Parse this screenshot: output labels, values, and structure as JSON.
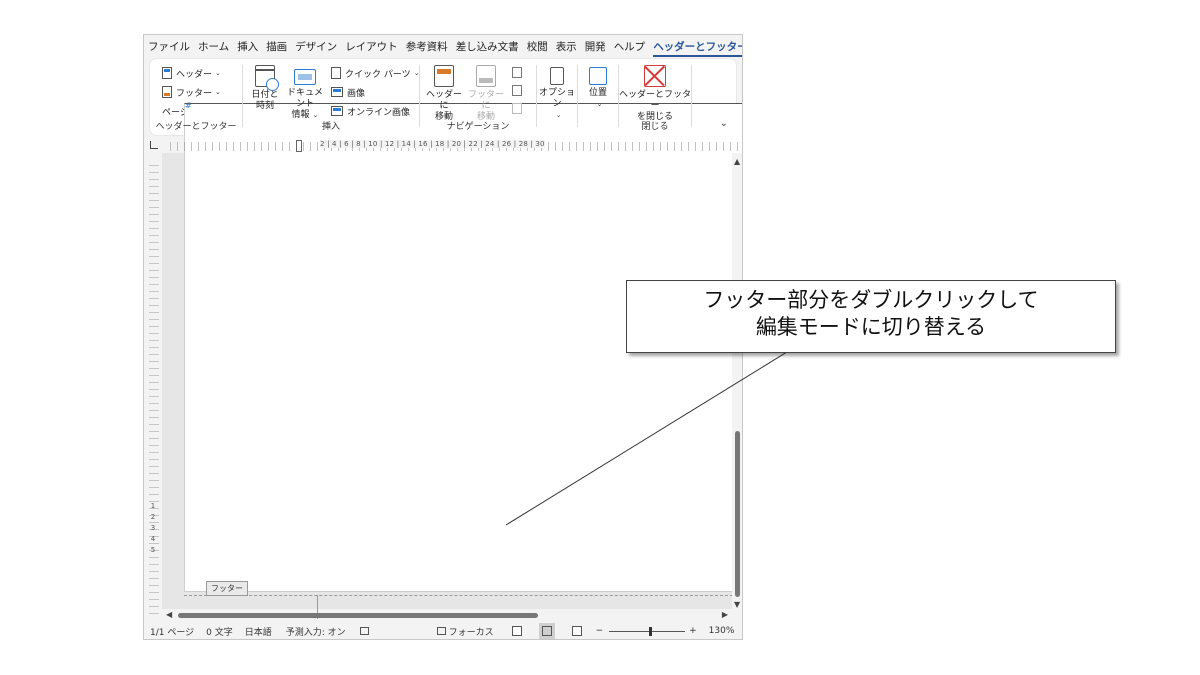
{
  "menu": {
    "tabs": [
      "ファイル",
      "ホーム",
      "挿入",
      "描画",
      "デザイン",
      "レイアウト",
      "参考資料",
      "差し込み文書",
      "校閲",
      "表示",
      "開発",
      "ヘルプ"
    ],
    "active_tab": "ヘッダーとフッター"
  },
  "ribbon": {
    "header_footer": {
      "header": "ヘッダー",
      "footer": "フッター",
      "page_number": "ページ番号",
      "label": "ヘッダーとフッター"
    },
    "insert": {
      "date_time_1": "日付と",
      "date_time_2": "時刻",
      "doc_info_1": "ドキュメント",
      "doc_info_2": "情報",
      "quick_parts": "クイック パーツ",
      "picture": "画像",
      "online_picture": "オンライン画像",
      "label": "挿入"
    },
    "navigation": {
      "go_header_1": "ヘッダーに",
      "go_header_2": "移動",
      "go_footer_1": "フッターに",
      "go_footer_2": "移動",
      "label": "ナビゲーション"
    },
    "options": {
      "label": "オプション"
    },
    "position": {
      "label": "位置"
    },
    "close": {
      "close_1": "ヘッダーとフッター",
      "close_2": "を閉じる",
      "label": "閉じる"
    }
  },
  "ruler": {
    "numbers": "2 | 4 | 6 | 8 | 10 | 12 | 14 | 16 | 18 | 20 | 22 | 24 | 26 | 28 | 30",
    "vertical_numbers": [
      "1",
      "2",
      "3",
      "4",
      "5"
    ]
  },
  "document": {
    "footer_tag": "フッター",
    "paragraph_mark": "↵"
  },
  "status": {
    "page": "1/1 ページ",
    "words": "0 文字",
    "language": "日本語",
    "predictive": "予測入力: オン",
    "focus": "フォーカス",
    "zoom": "130%",
    "zoom_minus": "−",
    "zoom_plus": "+"
  },
  "callout": {
    "line1": "フッター部分をダブルクリックして",
    "line2": "編集モードに切り替える"
  }
}
